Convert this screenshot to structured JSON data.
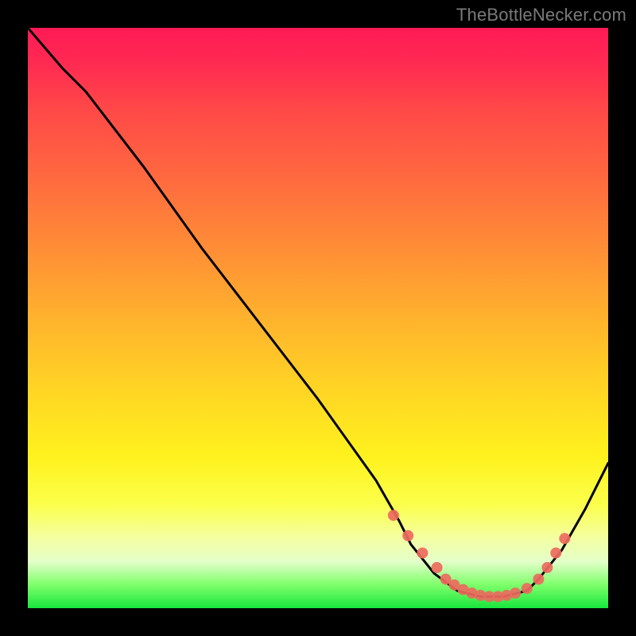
{
  "watermark": {
    "text": "TheBottleNecker.com"
  },
  "chart_data": {
    "type": "line",
    "title": "",
    "xlabel": "",
    "ylabel": "",
    "xlim": [
      0,
      100
    ],
    "ylim": [
      0,
      100
    ],
    "series": [
      {
        "name": "curve",
        "x": [
          0,
          6,
          10,
          20,
          30,
          40,
          50,
          60,
          64,
          66,
          70,
          74,
          78,
          82,
          86,
          88,
          92,
          96,
          100
        ],
        "y": [
          100,
          93,
          89,
          76,
          62,
          49,
          36,
          22,
          15,
          11,
          6,
          3,
          2,
          2,
          3,
          5,
          10,
          17,
          25
        ]
      }
    ],
    "markers": {
      "name": "dots",
      "x": [
        63,
        65.5,
        68,
        70.5,
        72,
        73.5,
        75,
        76.5,
        78,
        79.5,
        81,
        82.5,
        84,
        86,
        88,
        89.5,
        91,
        92.5
      ],
      "y": [
        16,
        12.5,
        9.5,
        7,
        5,
        4,
        3.2,
        2.6,
        2.2,
        2,
        2,
        2.2,
        2.6,
        3.4,
        5,
        7,
        9.5,
        12
      ]
    },
    "marker_color": "#ed6a5e",
    "line_color": "#000000",
    "background": "heat-gradient"
  }
}
